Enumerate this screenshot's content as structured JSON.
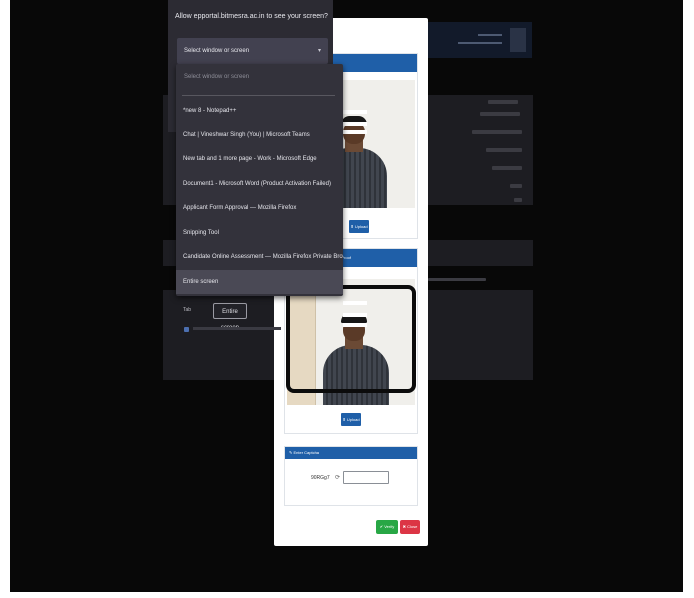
{
  "share_dialog": {
    "title": "Allow epportal.bitmesra.ac.in to see your screen?",
    "select_value": "Select window or screen",
    "dropdown": {
      "placeholder": "Select window or screen",
      "items": [
        "*new 8 - Notepad++",
        "Chat | Vineshwar Singh (You) | Microsoft Teams",
        "New tab and 1 more page - Work - Microsoft Edge",
        "Document1 - Microsoft Word (Product Activation Failed)",
        "Applicant Form Approval — Mozilla Firefox",
        "Snipping Tool",
        "Candidate Online Assessment — Mozilla Firefox Private Browsing",
        "Entire screen"
      ],
      "selected_index": 7
    },
    "entire_screen_button": "Entire screen",
    "side_label": "Tab"
  },
  "modal": {
    "photo_panel": {
      "upload_label": "⬆ Upload"
    },
    "id_panel": {
      "header": "with Valid Id Proof",
      "upload_label": "⬆ Upload"
    },
    "captcha": {
      "label": "✎ Enter Captcha",
      "code": "90RGg7",
      "refresh_icon": "⟳",
      "input_value": ""
    },
    "verify_label": "✔ Verify",
    "close_label": "✖ Close"
  },
  "colors": {
    "header_blue": "#1f5fa8",
    "verify_green": "#28a745",
    "close_red": "#dc3545",
    "dialog_bg": "#2c2b33"
  }
}
